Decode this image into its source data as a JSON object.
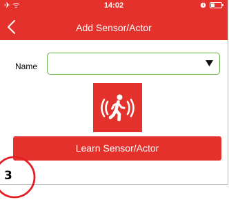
{
  "status_bar": {
    "left_icons": "✈ ᯤ",
    "time": "14:02",
    "icons": [
      "airplane-mode-icon",
      "wifi-icon",
      "alarm-icon",
      "battery-icon"
    ]
  },
  "nav": {
    "title": "Add Sensor/Actor",
    "back_icon": "chevron-left-icon"
  },
  "form": {
    "name_label": "Name",
    "name_value": "",
    "dropdown_icon": "caret-down-icon"
  },
  "sensor_image": {
    "icon": "motion-sensor-icon"
  },
  "learn_button": {
    "label": "Learn Sensor/Actor"
  },
  "step_marker": {
    "number": "3"
  },
  "colors": {
    "brand_red": "#e4312b",
    "select_border": "#6ab04c",
    "marker_red": "#e31e24",
    "text": "#000000",
    "white": "#ffffff"
  }
}
